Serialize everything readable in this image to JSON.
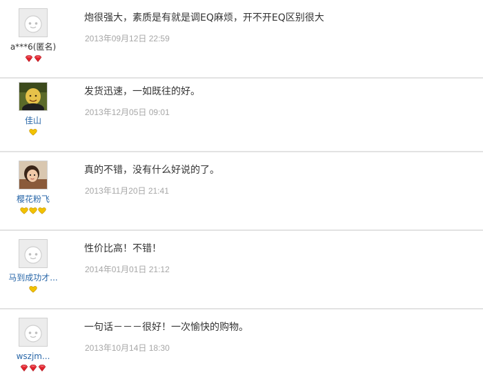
{
  "reviews": [
    {
      "username": "a***6(匿名)",
      "avatar_icon": "default-avatar-icon",
      "badge_type": "diamond",
      "badge_count": 2,
      "comment": "炮很强大，素质是有就是调EQ麻烦，开不开EQ区别很大",
      "timestamp": "2013年09月12日 22:59"
    },
    {
      "username": "佳山",
      "avatar_icon": "user-photo-icon",
      "badge_type": "heart",
      "badge_count": 1,
      "comment": "发货迅速，一如既往的好。",
      "timestamp": "2013年12月05日 09:01"
    },
    {
      "username": "樱花粉飞",
      "avatar_icon": "user-photo-icon",
      "badge_type": "heart",
      "badge_count": 3,
      "comment": "真的不错，没有什么好说的了。",
      "timestamp": "2013年11月20日 21:41"
    },
    {
      "username": "马到成功才...",
      "avatar_icon": "default-avatar-icon",
      "badge_type": "heart",
      "badge_count": 1,
      "comment": "性价比高！不错！",
      "timestamp": "2014年01月01日 21:12"
    },
    {
      "username": "wszjm...",
      "avatar_icon": "default-avatar-icon",
      "badge_type": "diamond",
      "badge_count": 3,
      "comment": "一句话－－－很好！一次愉快的购物。",
      "timestamp": "2013年10月14日 18:30"
    }
  ],
  "colors": {
    "link": "#2866a8",
    "anon_name": "#333333",
    "comment_text": "#333333",
    "timestamp": "#a6a6a6",
    "divider": "#e2e2e2",
    "heart_badge": "#f2c200",
    "diamond_badge": "#e0212b"
  }
}
